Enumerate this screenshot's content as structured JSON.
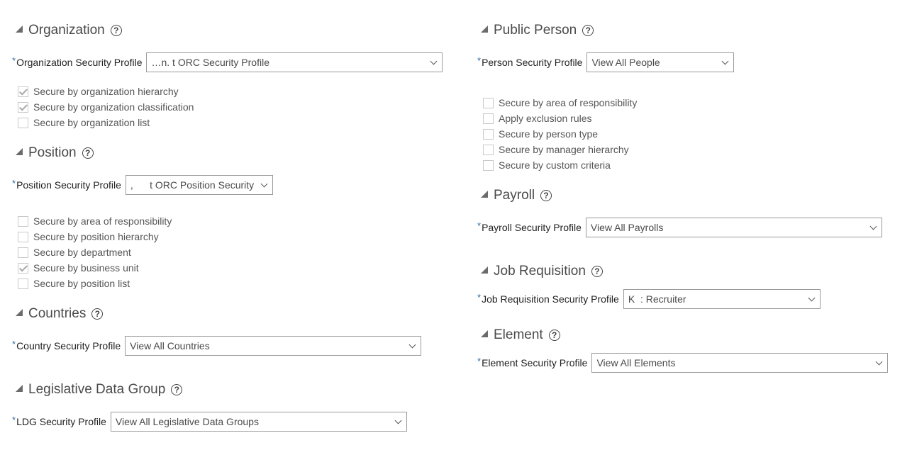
{
  "left": {
    "organization": {
      "title": "Organization",
      "help": "?",
      "field": {
        "required": "*",
        "label": "Organization Security Profile",
        "value": "…n. t ORC Security Profile"
      },
      "options": [
        {
          "label": "Secure by organization hierarchy",
          "checked": true
        },
        {
          "label": "Secure by organization classification",
          "checked": true
        },
        {
          "label": "Secure by organization list",
          "checked": false
        }
      ]
    },
    "position": {
      "title": "Position",
      "help": "?",
      "field": {
        "required": "*",
        "label": "Position Security Profile",
        "value": ",      t ORC Position Security"
      },
      "options": [
        {
          "label": "Secure by area of responsibility",
          "checked": false
        },
        {
          "label": "Secure by position hierarchy",
          "checked": false
        },
        {
          "label": "Secure by department",
          "checked": false
        },
        {
          "label": "Secure by business unit",
          "checked": true
        },
        {
          "label": "Secure by position list",
          "checked": false
        }
      ]
    },
    "countries": {
      "title": "Countries",
      "help": "?",
      "field": {
        "required": "*",
        "label": "Country Security Profile",
        "value": "View All Countries"
      }
    },
    "ldg": {
      "title": "Legislative Data Group",
      "help": "?",
      "field": {
        "required": "*",
        "label": "LDG Security Profile",
        "value": "View All Legislative Data Groups"
      }
    }
  },
  "right": {
    "person": {
      "title": "Public Person",
      "help": "?",
      "field": {
        "required": "*",
        "label": "Person Security Profile",
        "value": "View All People"
      },
      "options": [
        {
          "label": "Secure by area of responsibility",
          "checked": false
        },
        {
          "label": "Apply exclusion rules",
          "checked": false
        },
        {
          "label": "Secure by person type",
          "checked": false
        },
        {
          "label": "Secure by manager hierarchy",
          "checked": false
        },
        {
          "label": "Secure by custom criteria",
          "checked": false
        }
      ]
    },
    "payroll": {
      "title": "Payroll",
      "help": "?",
      "field": {
        "required": "*",
        "label": "Payroll Security Profile",
        "value": "View All Payrolls"
      }
    },
    "job": {
      "title": "Job Requisition",
      "help": "?",
      "field": {
        "required": "*",
        "label": "Job Requisition Security Profile",
        "value": "K  : Recruiter"
      }
    },
    "element": {
      "title": "Element",
      "help": "?",
      "field": {
        "required": "*",
        "label": "Element Security Profile",
        "value": "View All Elements"
      }
    }
  }
}
